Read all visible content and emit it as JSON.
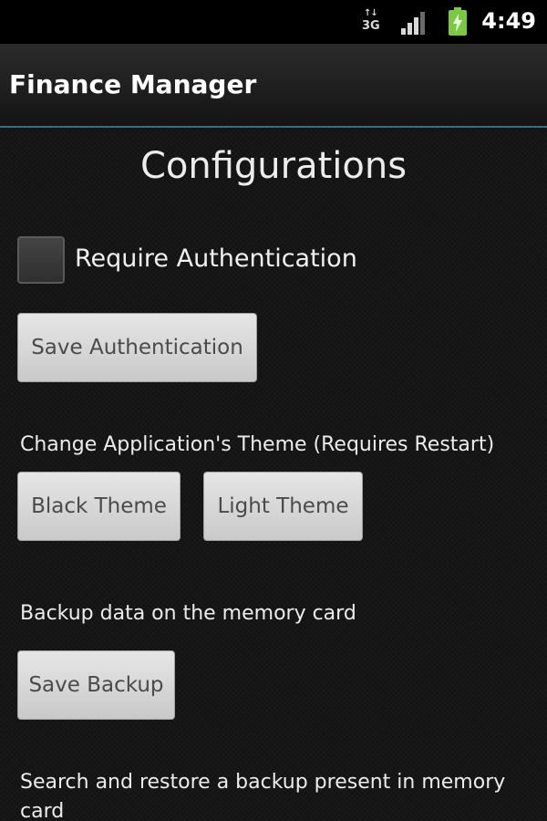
{
  "status_bar": {
    "network_arrows": "↑↓",
    "network_type": "3G",
    "time": "4:49",
    "icons": [
      "network-3g-icon",
      "signal-strength-icon",
      "battery-charging-icon"
    ]
  },
  "title_bar": {
    "title": "Finance Manager"
  },
  "main": {
    "title": "Configurations",
    "auth_checkbox": {
      "label": "Require Authentication",
      "checked": false
    },
    "save_auth_label": "Save Authentication",
    "theme_text": "Change Application's Theme (Requires Restart)",
    "black_theme_label": "Black Theme",
    "light_theme_label": "Light Theme",
    "backup_text": "Backup data on the memory card",
    "save_backup_label": "Save Backup",
    "restore_text": "Search and restore a backup present in memory card"
  },
  "colors": {
    "background": "#161616",
    "title_bar_underline": "#3a6f80",
    "button_face": "#dcdcdc",
    "button_text": "#4a4a4a",
    "battery": "#7ac943"
  }
}
